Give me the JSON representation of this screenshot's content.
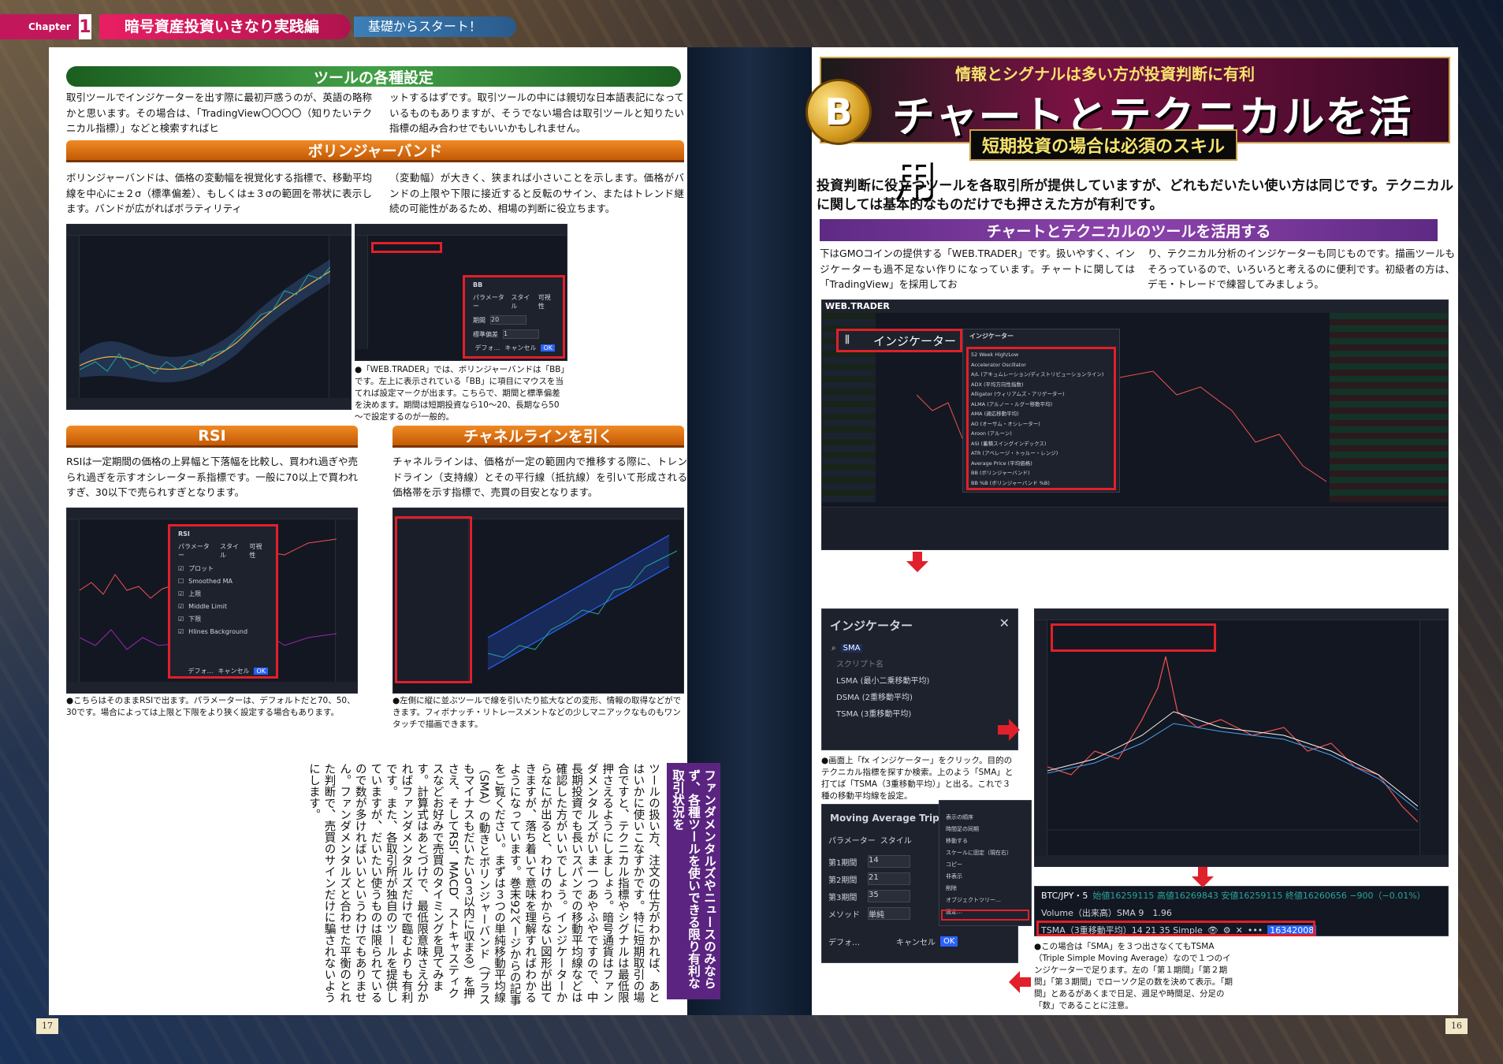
{
  "header": {
    "chapter_label": "Chapter",
    "chapter_num": "1",
    "chapter_title": "暗号資産投資いきなり実践編",
    "chapter_sub": "基礎からスタート！"
  },
  "left": {
    "tools_heading": "ツールの各種設定",
    "tools_text_1": "取引ツールでインジケーターを出す際に最初戸惑うのが、英語の略称かと思います。その場合は、「TradingView〇〇〇〇（知りたいテクニカル指標）」などと検索すればヒ",
    "tools_text_2": "ットするはずです。取引ツールの中には親切な日本語表記になっているものもありますが、そうでない場合は取引ツールと知りたい指標の組み合わせでもいいかもしれません。",
    "bb_heading": "ボリンジャーバンド",
    "bb_text_1": "ボリンジャーバンドは、価格の変動幅を視覚化する指標で、移動平均線を中心に±２σ（標準偏差）、もしくは±３σの範囲を帯状に表示します。バンドが広がればボラティリティ",
    "bb_text_2": "（変動幅）が大きく、狭まれば小さいことを示します。価格がバンドの上限や下限に接近すると反転のサイン、またはトレンド継続の可能性があるため、相場の判断に役立ちます。",
    "bb_caption": "●「WEB.TRADER」では、ボリンジャーバンドは「BB」です。左上に表示されている「BB」に項目にマウスを当てれば設定マークが出ます。こちらで、期間と標準偏差を決めます。期間は短期投資なら10～20、長期なら50～で設定するのが一般的。",
    "bb_dialog": {
      "title": "BB",
      "tabs": [
        "パラメーター",
        "スタイル",
        "可視性"
      ],
      "period_label": "期間",
      "period": "20",
      "stddev_label": "標準偏差",
      "stddev": "1",
      "default": "デフォ…",
      "cancel": "キャンセル",
      "ok": "OK"
    },
    "rsi_heading": "RSI",
    "rsi_text": "RSIは一定期間の価格の上昇幅と下落幅を比較し、買われ過ぎや売られ過ぎを示すオシレーター系指標です。一般に70以上で買われすぎ、30以下で売られすぎとなります。",
    "rsi_caption": "●こちらはそのままRSIで出ます。パラメーターは、デフォルトだと70、50、30です。場合によっては上限と下限をより狭く設定する場合もあります。",
    "rsi_dialog": {
      "title": "RSI",
      "tabs": [
        "パラメーター",
        "スタイル",
        "可視性"
      ],
      "rows": [
        "プロット",
        "Smoothed MA",
        "上限",
        "Middle Limit",
        "下限",
        "Hlines Background"
      ],
      "default": "デフォ…",
      "cancel": "キャンセル",
      "ok": "OK"
    },
    "channel_heading": "チャネルラインを引く",
    "channel_text": "チャネルラインは、価格が一定の範囲内で推移する際に、トレンドライン（支持線）とその平行線（抵抗線）を引いて形成される価格帯を示す指標で、売買の目安となります。",
    "channel_caption": "●左側に縦に並ぶツールで線を引いたり拡大などの変形、情報の取得などができます。フィボナッチ・リトレースメントなどの少しマニアックなものもワンタッチで描画できます。",
    "vertical_heading": "ファンダメンタルズやニュースのみならず、各種ツールを使いできる限り有利な取引状況を",
    "vertical_text": "ツールの扱い方、注文の仕方がわかれば、あとはいかに使いこなすかです。特に短期取引の場合ですと、テクニカル指標やシグナルは最低限押さえるようにしましょう。暗号通貨はファンダメンタルズがいま一つあやふやですので、中長期投資でも長いスパンでの移動平均線などは確認した方がいいでしょう。インジケーターからなにが出ると、わけのわからない図形が出てきますが、落ち着いて意味を理解すればわかるようになっています。巻末92ページからの記事をご覧ください。まずは３つの単純移動平均線（SMA）の動きとボリンジャーバンド（プラスもマイナスもだいたいσ３以内に収まる）を押さえ、そしてRSI、MACD、ストキャスティクスなどお好みで売買のタイミングを見てみます。計算式はあとづけで、最低限意味さえ分かればファンダメンタルズだけで臨むよりも有利です。また、各取引所が独自のツールを提供していますが、だいたい使うものは限られているので数が多ければいいというわけでもありません。ファンダメンタルズと合わせた平衡のとれた判断で、売買のサインだけに騙されないようにします。",
    "page_num": "17"
  },
  "right": {
    "title_top": "情報とシグナルは多い方が投資判断に有利",
    "title_main": "チャートとテクニカルを活用",
    "title_sub": "短期投資の場合は必須のスキル",
    "coin_letter": "B",
    "lead": "投資判断に役立つツールを各取引所が提供していますが、どれもだいたい使い方は同じです。テクニカルに関しては基本的なものだけでも押さえた方が有利です。",
    "tools_heading": "チャートとテクニカルのツールを活用する",
    "tools_text_1": "下はGMOコインの提供する「WEB.TRADER」です。扱いやすく、インジケーターも過不足ない作りになっています。チャートに関しては「TradingView」を採用してお",
    "tools_text_2": "り、テクニカル分析のインジケーターも同じものです。描画ツールもそろっているので、いろいろと考えるのに便利です。初級者の方は、デモ・トレードで練習してみましょう。",
    "webtrader_logo": "WEB.TRADER",
    "indicator_button": "インジケーター",
    "indicator_panel_title": "インジケーター",
    "indicator_list": [
      "52 Week High/Low",
      "Accelerator Oscillator",
      "A/L (アキュムレーション/ディストリビューションライン)",
      "ADX (平均方向性指数)",
      "Alligator (ウィリアムズ・アリゲーター)",
      "ALMA (アルノー・ルグー移動平均)",
      "AMA (適応移動平均)",
      "AO (オーサム・オシレーター)",
      "Aroon (アルーン)",
      "ASI (蓄積スイングインデックス)",
      "ATR (アベレージ・トゥルー・レンジ)",
      "Average Price (平均価格)",
      "BB (ボリンジャーバンド)",
      "BB %B (ボリンジャーバンド %B)"
    ],
    "search_panel": {
      "title": "インジケーター",
      "query": "SMA",
      "section": "スクリプト名",
      "results": [
        "LSMA (最小二乗移動平均)",
        "DSMA (2重移動平均)",
        "TSMA (3重移動平均)"
      ]
    },
    "search_caption": "●画面上「fx インジケーター」をクリック。目的のテクニカル指標を探すか検索。上のよう「SMA」と打てば「TSMA（3重移動平均）」と出る。これで３種の移動平均線を設定。",
    "ma_dialog": {
      "title": "Moving Average Triple",
      "tabs": [
        "パラメーター",
        "スタイル"
      ],
      "rows": [
        [
          "第1期間",
          "14"
        ],
        [
          "第2期間",
          "21"
        ],
        [
          "第3期間",
          "35"
        ],
        [
          "メソッド",
          "単純"
        ]
      ],
      "default": "デフォ…",
      "cancel": "キャンセル",
      "ok": "OK"
    },
    "context_menu": [
      "表示の順序",
      "時間足の同期",
      "移動する",
      "スケールに固定（現在右）",
      "コピー",
      "非表示",
      "削除",
      "オブジェクトツリー…",
      "設定…"
    ],
    "legend": {
      "symbol": "BTC/JPY・5",
      "ohlc": "始値16259115 高値16269843 安値16259115 終値16260656 −900（−0.01%）",
      "volume": "Volume（出来高）SMA 9　1.96",
      "tsma": "TSMA（3重移動平均）14 21 35 Simple",
      "tsma_value": "16342008"
    },
    "tsma_caption": "●この場合は「SMA」を３つ出さなくてもTSMA（Triple Simple Moving Average）なので１つのインジケーターで足ります。左の「第１期間」「第２期間」「第３期間」でローソク足の数を決めて表示。「期間」とあるがあくまで日足、週足や時間足、分足の「数」であることに注意。",
    "page_num": "16"
  },
  "colors": {
    "accent_red": "#e0202a",
    "bull": "#26a69a",
    "bear": "#ef5350",
    "orange_head": "#e67817",
    "purple_head": "#7b3a9c"
  }
}
